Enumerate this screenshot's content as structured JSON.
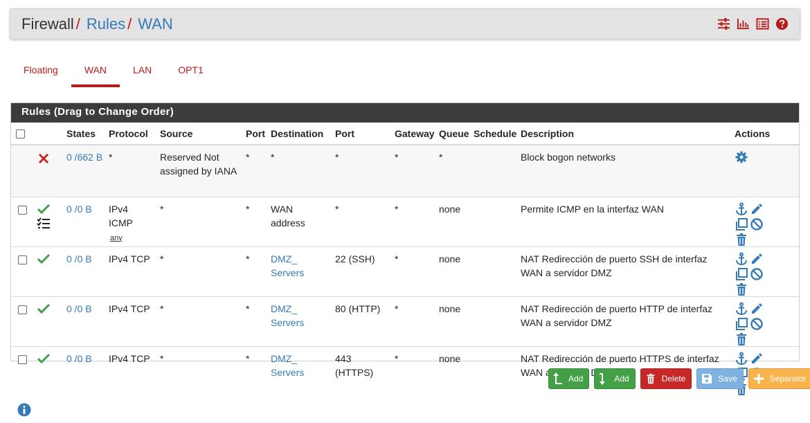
{
  "breadcrumb": {
    "root": "Firewall",
    "sep": "/",
    "rules": "Rules",
    "iface": "WAN"
  },
  "header_icons": [
    "sliders-icon",
    "bar-chart-icon",
    "list-icon",
    "help-icon"
  ],
  "tabs": [
    {
      "label": "Floating",
      "active": false
    },
    {
      "label": "WAN",
      "active": true
    },
    {
      "label": "LAN",
      "active": false
    },
    {
      "label": "OPT1",
      "active": false
    }
  ],
  "panel": {
    "title": "Rules (Drag to Change Order)"
  },
  "columns": [
    "States",
    "Protocol",
    "Source",
    "Port",
    "Destination",
    "Port",
    "Gateway",
    "Queue",
    "Schedule",
    "Description",
    "Actions"
  ],
  "rows": [
    {
      "status": "block",
      "states": "0 /662 B",
      "protocol": "*",
      "protocol_sub": "",
      "source": "Reserved Not assigned by IANA",
      "src_port": "*",
      "destination": "*",
      "dest_link": false,
      "dst_port": "*",
      "gateway": "*",
      "queue": "*",
      "schedule": "",
      "description": "Block bogon networks"
    },
    {
      "status": "pass",
      "states": "0 /0 B",
      "protocol": "IPv4 ICMP",
      "protocol_sub": "any",
      "source": "*",
      "src_port": "*",
      "destination": "WAN address",
      "dest_link": false,
      "dst_port": "*",
      "gateway": "*",
      "queue": "none",
      "schedule": "",
      "description": "Permite ICMP en la interfaz WAN"
    },
    {
      "status": "pass",
      "states": "0 /0 B",
      "protocol": "IPv4 TCP",
      "protocol_sub": "",
      "source": "*",
      "src_port": "*",
      "destination": "DMZ_ Servers",
      "dest_link": true,
      "dst_port": "22 (SSH)",
      "gateway": "*",
      "queue": "none",
      "schedule": "",
      "description": "NAT Redirección de puerto SSH de interfaz WAN a servidor DMZ"
    },
    {
      "status": "pass",
      "states": "0 /0 B",
      "protocol": "IPv4 TCP",
      "protocol_sub": "",
      "source": "*",
      "src_port": "*",
      "destination": "DMZ_ Servers",
      "dest_link": true,
      "dst_port": "80 (HTTP)",
      "gateway": "*",
      "queue": "none",
      "schedule": "",
      "description": "NAT Redirección de puerto HTTP de interfaz WAN a servidor DMZ"
    },
    {
      "status": "pass",
      "states": "0 /0 B",
      "protocol": "IPv4 TCP",
      "protocol_sub": "",
      "source": "*",
      "src_port": "*",
      "destination": "DMZ_ Servers",
      "dest_link": true,
      "dst_port": "443 (HTTPS)",
      "gateway": "*",
      "queue": "none",
      "schedule": "",
      "description": "NAT Redirección de puerto HTTPS de interfaz WAN a servidor DM"
    }
  ],
  "buttons": {
    "add_top": "Add",
    "add_bottom": "Add",
    "delete": "Delete",
    "save": "Save",
    "separator": "Separator"
  },
  "colors": {
    "accent_red": "#b71c1c",
    "link_blue": "#337ab7",
    "pass_green": "#43a047",
    "panel_dark": "#3c3c3c"
  }
}
